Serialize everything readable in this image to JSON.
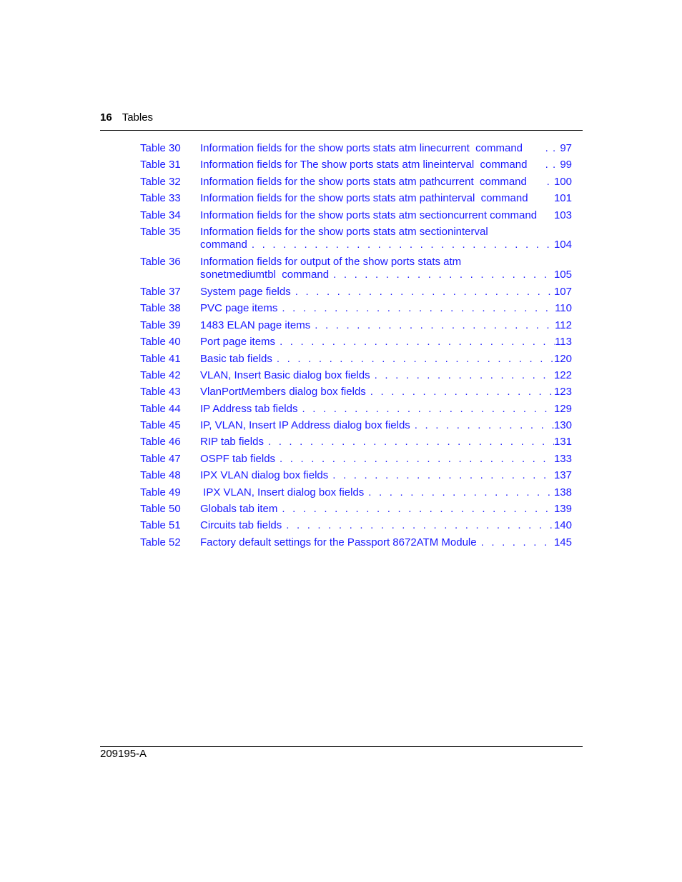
{
  "header": {
    "page_number": "16",
    "section": "Tables"
  },
  "footer": {
    "doc_id": "209195-A"
  },
  "entries": [
    {
      "label": "Table 30",
      "lines": [
        "Information fields for the show ports stats atm linecurrent  command"
      ],
      "page": "97",
      "dots": "  . . "
    },
    {
      "label": "Table 31",
      "lines": [
        "Information fields for The show ports stats atm lineinterval  command"
      ],
      "page": "99",
      "dots": " . . "
    },
    {
      "label": "Table 32",
      "lines": [
        "Information fields for the show ports stats atm pathcurrent  command"
      ],
      "page": "100",
      "dots": " . "
    },
    {
      "label": "Table 33",
      "lines": [
        "Information fields for the show ports stats atm pathinterval  command"
      ],
      "page": "101",
      "dots": "   "
    },
    {
      "label": "Table 34",
      "lines": [
        "Information fields for the show ports stats atm sectioncurrent command"
      ],
      "page": "103",
      "dots": " "
    },
    {
      "label": "Table 35",
      "lines": [
        "Information fields for the show ports stats atm sectioninterval",
        "command"
      ],
      "page": "104"
    },
    {
      "label": "Table 36",
      "lines": [
        "Information fields for output of the show ports stats atm",
        "sonetmediumtbl  command"
      ],
      "page": "105"
    },
    {
      "label": "Table 37",
      "lines": [
        "System page fields"
      ],
      "page": "107"
    },
    {
      "label": "Table 38",
      "lines": [
        "PVC page items"
      ],
      "page": "110"
    },
    {
      "label": "Table 39",
      "lines": [
        "1483 ELAN page items"
      ],
      "page": "112"
    },
    {
      "label": "Table 40",
      "lines": [
        "Port page items"
      ],
      "page": "113"
    },
    {
      "label": "Table 41",
      "lines": [
        "Basic tab fields"
      ],
      "page": "120"
    },
    {
      "label": "Table 42",
      "lines": [
        "VLAN, Insert Basic dialog box fields"
      ],
      "page": "122"
    },
    {
      "label": "Table 43",
      "lines": [
        "VlanPortMembers dialog box fields"
      ],
      "page": "123"
    },
    {
      "label": "Table 44",
      "lines": [
        "IP Address tab fields"
      ],
      "page": "129"
    },
    {
      "label": "Table 45",
      "lines": [
        "IP, VLAN, Insert IP Address dialog box fields"
      ],
      "page": "130"
    },
    {
      "label": "Table 46",
      "lines": [
        "RIP tab fields"
      ],
      "page": "131"
    },
    {
      "label": "Table 47",
      "lines": [
        "OSPF tab fields"
      ],
      "page": "133"
    },
    {
      "label": "Table 48",
      "lines": [
        "IPX VLAN dialog box fields"
      ],
      "page": "137"
    },
    {
      "label": "Table 49",
      "lines": [
        " IPX VLAN, Insert dialog box fields"
      ],
      "page": "138"
    },
    {
      "label": "Table 50",
      "lines": [
        "Globals tab item"
      ],
      "page": "139"
    },
    {
      "label": "Table 51",
      "lines": [
        "Circuits tab fields"
      ],
      "page": "140"
    },
    {
      "label": "Table 52",
      "lines": [
        "Factory default settings for the Passport 8672ATM Module"
      ],
      "page": "145"
    }
  ]
}
